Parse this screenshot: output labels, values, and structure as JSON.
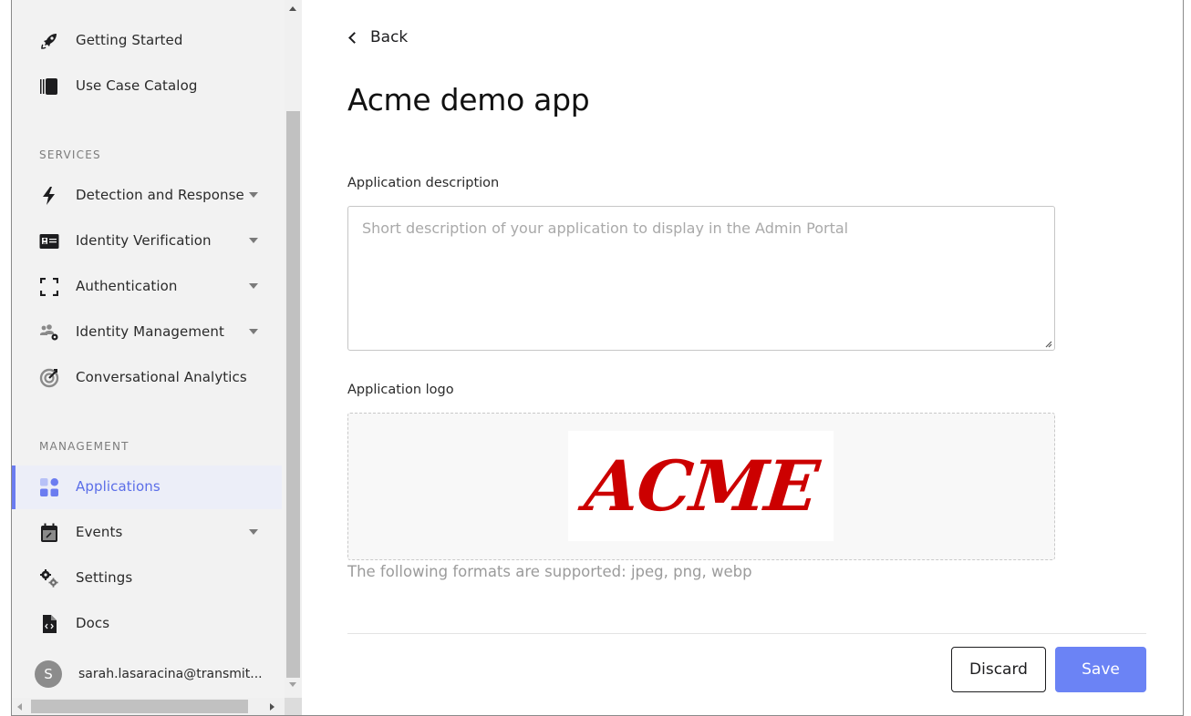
{
  "sidebar": {
    "top_items": [
      {
        "label": "Getting Started",
        "icon": "rocket-icon"
      },
      {
        "label": "Use Case Catalog",
        "icon": "catalog-icon"
      }
    ],
    "services_heading": "SERVICES",
    "services": [
      {
        "label": "Detection and Response",
        "icon": "lightning-icon",
        "expandable": true
      },
      {
        "label": "Identity Verification",
        "icon": "id-card-icon",
        "expandable": true
      },
      {
        "label": "Authentication",
        "icon": "scan-frame-icon",
        "expandable": true
      },
      {
        "label": "Identity Management",
        "icon": "users-gear-icon",
        "expandable": true
      },
      {
        "label": "Conversational Analytics",
        "icon": "target-icon",
        "expandable": false
      }
    ],
    "management_heading": "MANAGEMENT",
    "management": [
      {
        "label": "Applications",
        "icon": "grid-apps-icon",
        "active": true
      },
      {
        "label": "Events",
        "icon": "calendar-icon",
        "expandable": true
      },
      {
        "label": "Settings",
        "icon": "gears-icon"
      },
      {
        "label": "Docs",
        "icon": "code-file-icon"
      }
    ],
    "user": {
      "initial": "S",
      "email": "sarah.lasaracina@transmit..."
    }
  },
  "main": {
    "back_label": "Back",
    "title": "Acme demo app",
    "description_label": "Application description",
    "description_value": "",
    "description_placeholder": "Short description of your application to display in the Admin Portal",
    "logo_label": "Application logo",
    "logo_text": "ACME",
    "formats_hint": "The following formats are supported: jpeg, png, webp",
    "discard_label": "Discard",
    "save_label": "Save"
  },
  "colors": {
    "accent": "#6b83f5",
    "active_text": "#5b6ee8",
    "sidebar_bg": "#f2f2f2",
    "logo_red": "#cc0000"
  }
}
